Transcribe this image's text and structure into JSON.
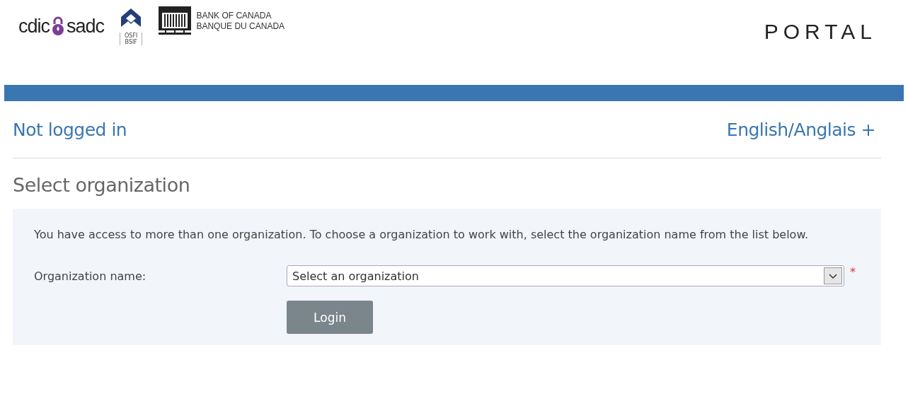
{
  "header": {
    "logos": [
      {
        "kind": "cdic",
        "left": "cdic",
        "right": "sadc"
      },
      {
        "kind": "osfi",
        "lines": [
          "OSFI",
          "BSIF"
        ]
      },
      {
        "kind": "boc",
        "lines": [
          "BANK OF CANADA",
          "BANQUE DU CANADA"
        ]
      }
    ],
    "title": "PORTAL"
  },
  "status": {
    "login_state": "Not logged in",
    "language": "English/Anglais",
    "language_icon": "+"
  },
  "page_title": "Select organization",
  "form": {
    "intro": "You have access to more than one organization. To choose a organization to work with, select the organization name from the list below.",
    "field_label": "Organization name:",
    "select": {
      "value": "Select an organization",
      "required": true,
      "required_mark": "*"
    },
    "button": "Login"
  }
}
